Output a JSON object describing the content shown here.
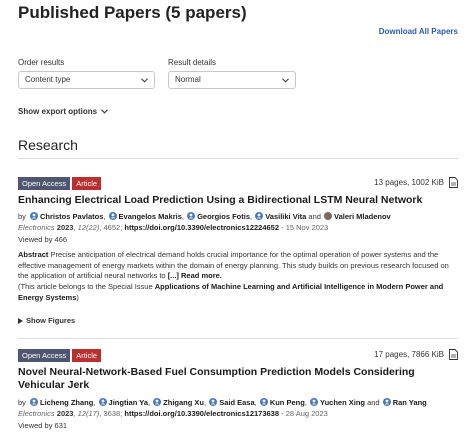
{
  "header": {
    "title": "Published Papers (5 papers)",
    "download_all": "Download All Papers"
  },
  "controls": {
    "order_label": "Order results",
    "order_value": "Content type",
    "details_label": "Result details",
    "details_value": "Normal",
    "show_export": "Show export options"
  },
  "section": {
    "title": "Research"
  },
  "articles": [
    {
      "badge_open_access": "Open Access",
      "badge_type": "Article",
      "pages_size": "13 pages, 1002 KiB",
      "title": "Enhancing Electrical Load Prediction Using a Bidirectional LSTM Neural Network",
      "by": "by",
      "authors": [
        "Christos Pavlatos",
        "Evangelos Makris",
        "Georgios Fotis",
        "Vasiliki Vita",
        "Valeri Mladenov"
      ],
      "journal": "Electronics",
      "year": "2023",
      "volume_issue": "12(22)",
      "article_no": "4652",
      "doi": "https://doi.org/10.3390/electronics12224652",
      "date": "15 Nov 2023",
      "viewed": "Viewed by 466",
      "abstract_label": "Abstract",
      "abstract_text": "Precise anticipation of electrical demand holds crucial importance for the optimal operation of power systems and the effective management of energy markets within the domain of energy planning. This study builds on previous research focused on the application of artificial neural networks to",
      "read_more": "[...] Read more.",
      "special_prefix": "(This article belongs to the Special Issue",
      "special_issue": "Applications of Machine Learning and Artificial Intelligence in Modern Power and Energy Systems",
      "special_suffix": ")",
      "show_figures": "Show Figures"
    },
    {
      "badge_open_access": "Open Access",
      "badge_type": "Article",
      "pages_size": "17 pages, 7866 KiB",
      "title": "Novel Neural-Network-Based Fuel Consumption Prediction Models Considering Vehicular Jerk",
      "by": "by",
      "authors": [
        "Licheng Zhang",
        "Jingtian Ya",
        "Zhigang Xu",
        "Said Easa",
        "Kun Peng",
        "Yuchen Xing",
        "Ran Yang"
      ],
      "journal": "Electronics",
      "year": "2023",
      "volume_issue": "12(17)",
      "article_no": "3638",
      "doi": "https://doi.org/10.3390/electronics12173638",
      "date": "28 Aug 2023",
      "viewed": "Viewed by 631"
    }
  ],
  "colors": {
    "link_blue": "#2a5db0",
    "open_access_bg": "#4f5671",
    "article_badge_bg": "#bc2f2f",
    "author_icon": "#4a78c4"
  }
}
